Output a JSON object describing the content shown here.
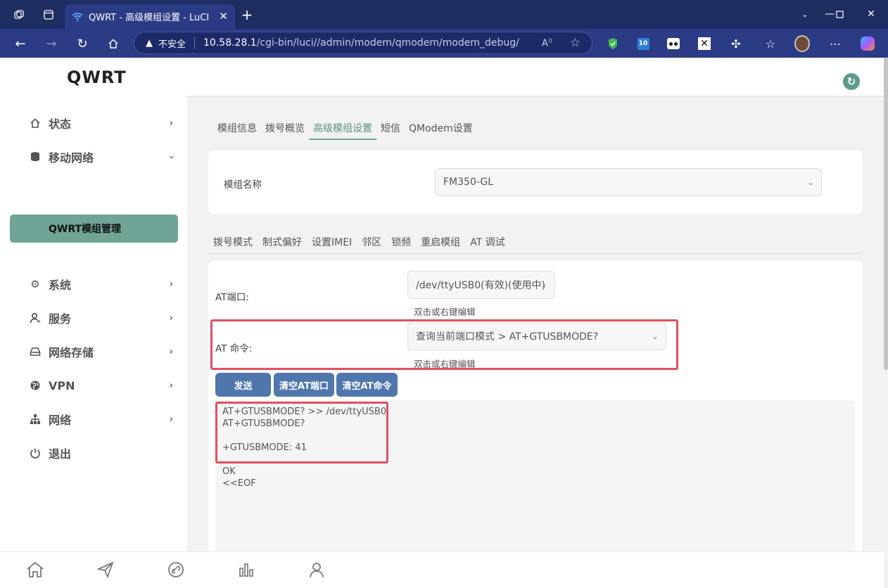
{
  "browser": {
    "tab_title": "QWRT - 高级模组设置 - LuCI",
    "insecure_label": "不安全",
    "url_host": "10.58.28.1",
    "url_path": "/cgi-bin/luci//admin/modem/qmodem/modem_debug/"
  },
  "header": {
    "brand": "QWRT"
  },
  "sidebar": {
    "items": [
      {
        "label": "状态"
      },
      {
        "label": "移动网络"
      },
      {
        "label": "QWRT模组管理"
      },
      {
        "label": "系统"
      },
      {
        "label": "服务"
      },
      {
        "label": "网络存储"
      },
      {
        "label": "VPN"
      },
      {
        "label": "网络"
      },
      {
        "label": "退出"
      }
    ]
  },
  "main": {
    "tabs": [
      "模组信息",
      "拨号概览",
      "高级模组设置",
      "短信",
      "QModem设置"
    ],
    "active_tab": "高级模组设置",
    "module_name_label": "模组名称",
    "module_name_value": "FM350-GL",
    "subtabs": [
      "拨号模式",
      "制式偏好",
      "设置IMEI",
      "邻区",
      "锁频",
      "重启模组",
      "AT 调试"
    ],
    "at_port_label": "AT端口:",
    "at_port_value": "/dev/ttyUSB0(有效)(使用中)",
    "hint_port": "双击或右键编辑",
    "at_command_label": "AT 命令:",
    "at_command_value": "查询当前端口模式 > AT+GTUSBMODE?",
    "hint_command": "双击或右键编辑",
    "buttons": {
      "send": "发送",
      "clear_port": "清空AT端口",
      "clear_command": "清空AT命令"
    },
    "output_lines": [
      "AT+GTUSBMODE? >> /dev/ttyUSB0",
      "AT+GTUSBMODE?",
      "",
      "+GTUSBMODE: 41",
      "",
      "OK",
      "<<EOF"
    ]
  },
  "colors": {
    "accent": "#6fa496",
    "button": "#4f77ad",
    "highlight": "#e2505f"
  }
}
